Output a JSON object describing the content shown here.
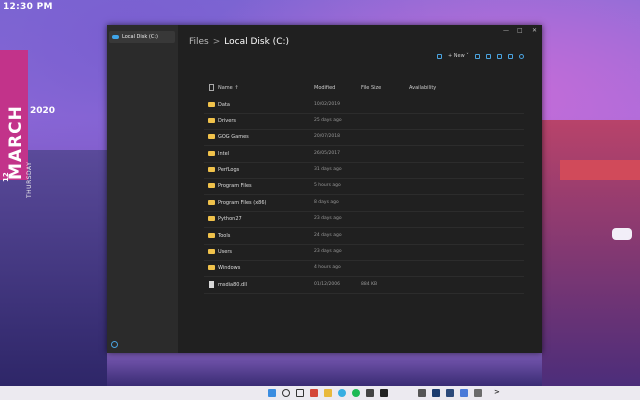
{
  "desktop": {
    "clock": "12:30 PM",
    "date_year": "2020",
    "date_day": "12",
    "date_month": "MARCH",
    "date_weekday": "THURSDAY"
  },
  "window": {
    "sidebar_item": "Local Disk (C:)",
    "breadcrumb": {
      "root": "Files",
      "sep": ">",
      "current": "Local Disk (C:)"
    },
    "controls": {
      "minimize": "—",
      "maximize": "□",
      "close": "✕"
    },
    "toolbar": {
      "new_label": "New"
    },
    "columns": {
      "name": "Name ↑",
      "modified": "Modified",
      "size": "File Size",
      "availability": "Availability"
    },
    "rows": [
      {
        "name": "Data",
        "modified": "10/02/2019",
        "size": "",
        "type": "folder"
      },
      {
        "name": "Drivers",
        "modified": "25 days ago",
        "size": "",
        "type": "folder"
      },
      {
        "name": "GOG Games",
        "modified": "20/07/2018",
        "size": "",
        "type": "folder"
      },
      {
        "name": "Intel",
        "modified": "26/05/2017",
        "size": "",
        "type": "folder"
      },
      {
        "name": "PerfLogs",
        "modified": "31 days ago",
        "size": "",
        "type": "folder"
      },
      {
        "name": "Program Files",
        "modified": "5 hours ago",
        "size": "",
        "type": "folder"
      },
      {
        "name": "Program Files (x86)",
        "modified": "8 days ago",
        "size": "",
        "type": "folder"
      },
      {
        "name": "Python27",
        "modified": "23 days ago",
        "size": "",
        "type": "folder"
      },
      {
        "name": "Tools",
        "modified": "24 days ago",
        "size": "",
        "type": "folder"
      },
      {
        "name": "Users",
        "modified": "23 days ago",
        "size": "",
        "type": "folder"
      },
      {
        "name": "Windows",
        "modified": "4 hours ago",
        "size": "",
        "type": "folder"
      },
      {
        "name": "msdia80.dll",
        "modified": "01/12/2006",
        "size": "884 KB",
        "type": "file"
      }
    ]
  },
  "taskbar": {
    "apps": [
      "windows-icon",
      "search-icon",
      "task-view-icon",
      "edge-icon",
      "gmail-icon",
      "folder-icon",
      "paint-icon",
      "telegram-icon",
      "app-icon",
      "spotify-icon",
      "xbox-icon",
      "terminal-icon",
      "settings-icon",
      "files-icon",
      "photoshop-icon",
      "lightroom-icon",
      "app-icon-2",
      "maps-icon",
      "store-icon"
    ],
    "tray_arrow": ">"
  },
  "colors": {
    "accent": "#4aa3df",
    "folder": "#f0c24b",
    "window_bg": "#202020",
    "sidebar_bg": "#2b2b2b"
  }
}
